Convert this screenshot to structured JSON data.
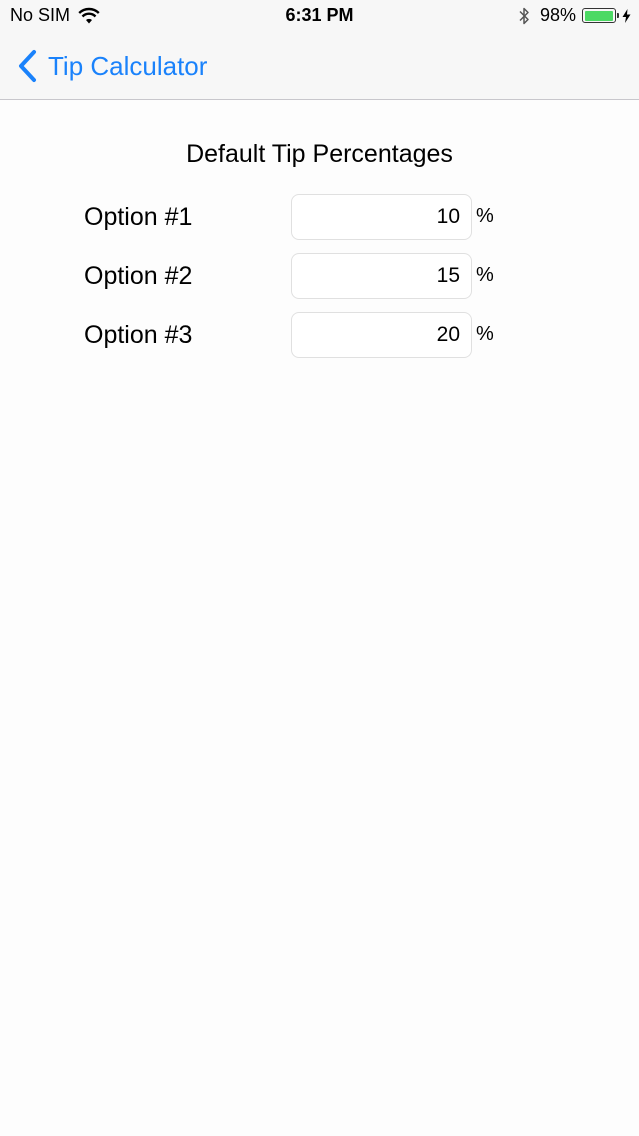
{
  "status_bar": {
    "carrier": "No SIM",
    "time": "6:31 PM",
    "battery_percent": "98%",
    "battery_level": 0.98,
    "battery_color": "#4cd964",
    "icons": [
      "wifi-icon",
      "bluetooth-icon",
      "battery-icon",
      "charging-bolt-icon"
    ]
  },
  "nav": {
    "back_label": "Tip Calculator",
    "back_icon": "chevron-left-icon",
    "accent_color": "#1a82fb"
  },
  "content": {
    "section_title": "Default Tip Percentages",
    "options": [
      {
        "label": "Option #1",
        "value": "10",
        "unit": "%"
      },
      {
        "label": "Option #2",
        "value": "15",
        "unit": "%"
      },
      {
        "label": "Option #3",
        "value": "20",
        "unit": "%"
      }
    ]
  }
}
